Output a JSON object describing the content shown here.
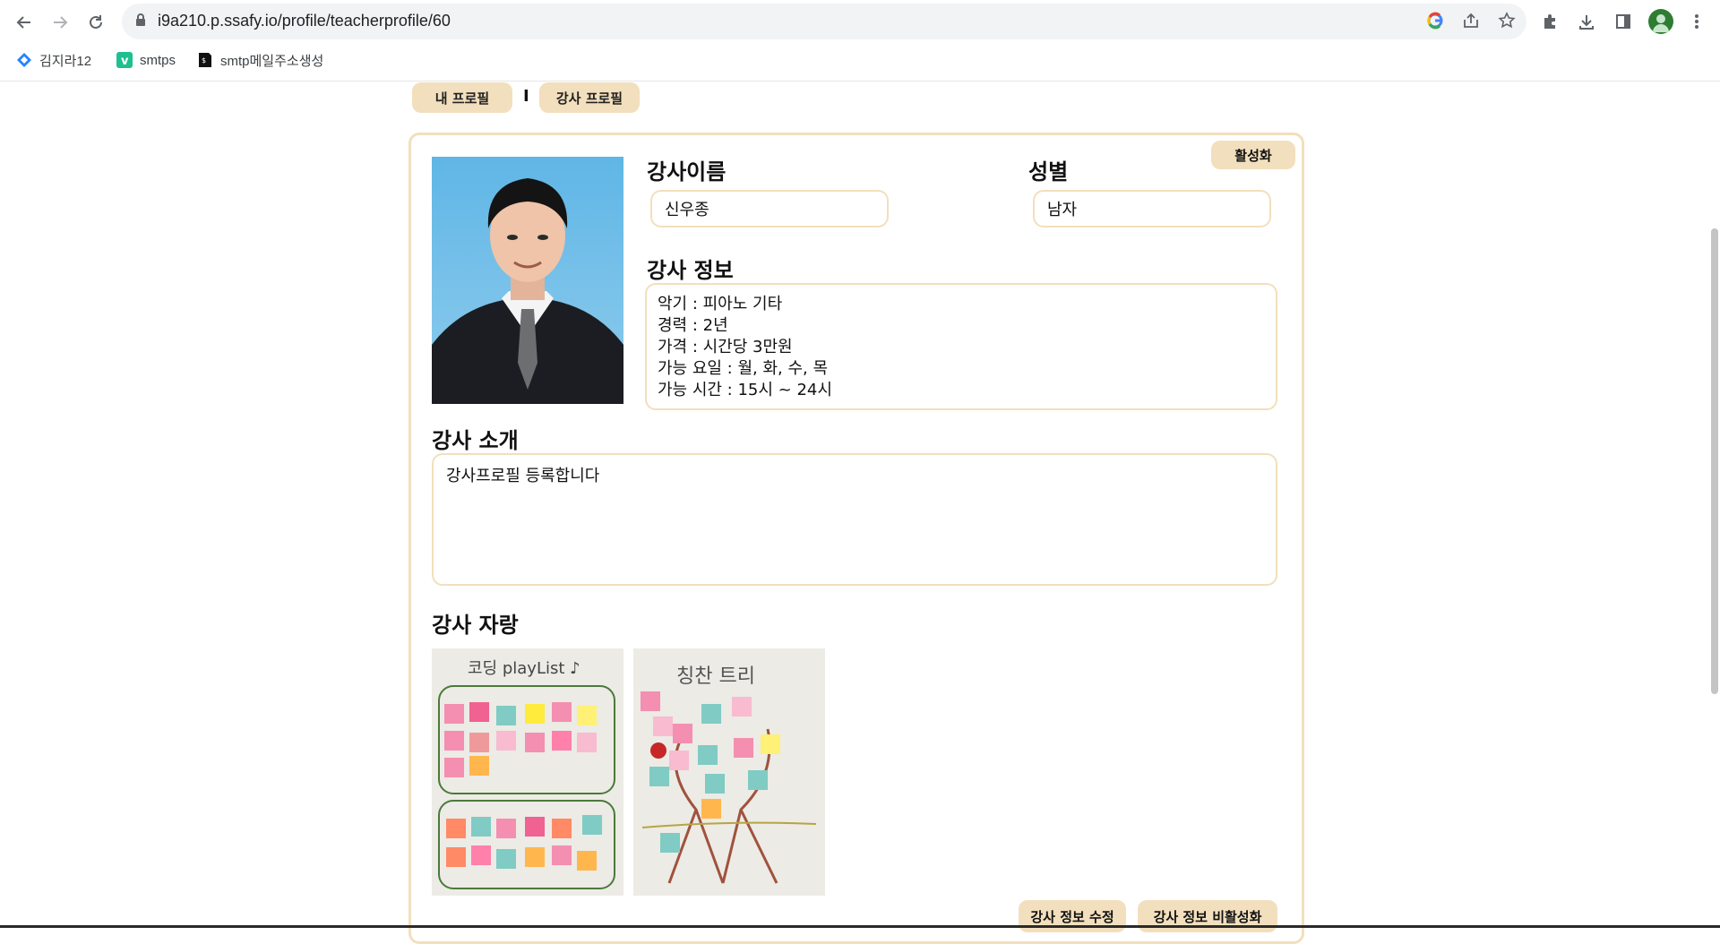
{
  "browser": {
    "url": "i9a210.p.ssafy.io/profile/teacherprofile/60",
    "bookmarks": [
      {
        "label": "김지라12",
        "icon": "jira-icon",
        "color": "#2684ff"
      },
      {
        "label": "smtps",
        "icon": "vercel-v-icon",
        "color": "#1fbf8f"
      },
      {
        "label": "smtp메일주소생성",
        "icon": "mail-doc-icon",
        "color": "#111111"
      }
    ]
  },
  "tabs": {
    "my_profile": "내 프로필",
    "separator": "I",
    "teacher_profile": "강사 프로필"
  },
  "profile": {
    "activate_button": "활성화",
    "name_heading": "강사이름",
    "name_value": "신우종",
    "gender_heading": "성별",
    "gender_value": "남자",
    "info_heading": "강사 정보",
    "info_lines": [
      "악기 : 피아노 기타",
      "경력 : 2년",
      "가격 : 시간당 3만원",
      "가능 요일 : 월, 화, 수, 목",
      "가능 시간 : 15시 ~ 24시"
    ],
    "intro_heading": "강사 소개",
    "intro_text": "강사프로필 등록합니다",
    "gallery_heading": "강사 자랑",
    "gallery": [
      {
        "caption_art": "코딩 playList ♪"
      },
      {
        "caption_art": "칭찬 트리"
      }
    ],
    "edit_button": "강사 정보 수정",
    "deactivate_button": "강사 정보 비활성화"
  },
  "colors": {
    "accent": "#f2dfbd",
    "text": "#111111"
  }
}
